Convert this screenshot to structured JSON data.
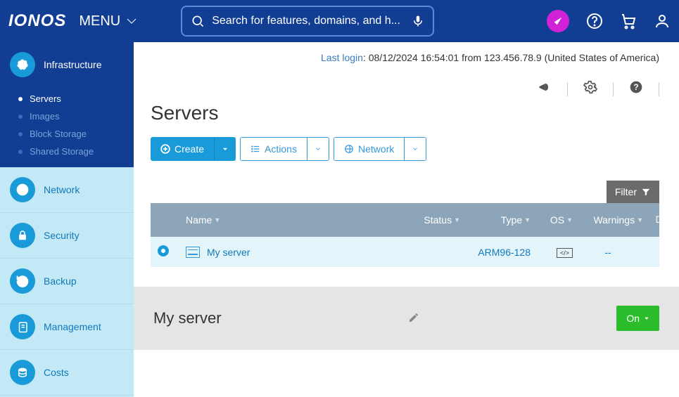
{
  "header": {
    "logo": "IONOS",
    "menu_label": "MENU",
    "search_placeholder": "Search for features, domains, and h..."
  },
  "sidebar": {
    "infrastructure_label": "Infrastructure",
    "sub": {
      "servers": "Servers",
      "images": "Images",
      "block_storage": "Block Storage",
      "shared_storage": "Shared Storage"
    },
    "network": "Network",
    "security": "Security",
    "backup": "Backup",
    "management": "Management",
    "costs": "Costs"
  },
  "last_login": {
    "label": "Last login",
    "value": ": 08/12/2024 16:54:01 from 123.456.78.9 (United States of America)"
  },
  "page_title": "Servers",
  "actions": {
    "create": "Create",
    "actions": "Actions",
    "network": "Network"
  },
  "filter_label": "Filter",
  "columns": {
    "name": "Name",
    "status": "Status",
    "type": "Type",
    "os": "OS",
    "warnings": "Warnings",
    "data_center": "Data center"
  },
  "rows": [
    {
      "name": "My server",
      "type": "ARM96-128",
      "os": "</>",
      "warnings": "--"
    }
  ],
  "detail": {
    "title": "My server",
    "power": "On"
  }
}
